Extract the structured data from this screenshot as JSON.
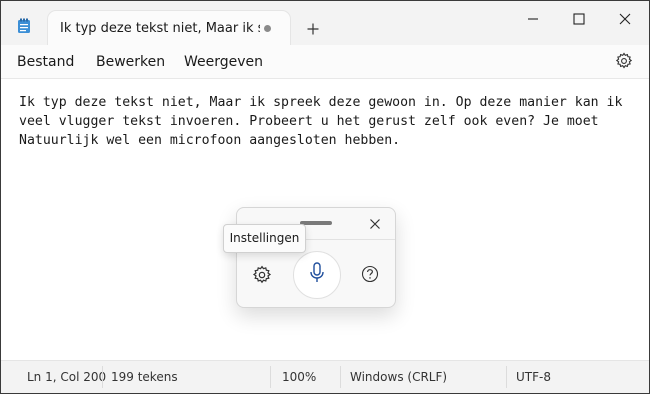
{
  "tab": {
    "title": "Ik typ deze tekst niet, Maar ik spr"
  },
  "icons": {
    "app": "notepad-icon",
    "new_tab": "plus-icon",
    "minimize": "minimize-icon",
    "maximize": "maximize-icon",
    "close": "close-icon",
    "settings": "gear-icon",
    "mic": "microphone-icon",
    "help": "question-mark-icon"
  },
  "menu": {
    "file": "Bestand",
    "edit": "Bewerken",
    "view": "Weergeven"
  },
  "editor": {
    "text": "Ik typ deze tekst niet, Maar ik spreek deze gewoon in. Op deze manier kan ik\nveel vlugger tekst invoeren. Probeert u het gerust zelf ook even? Je moet\nNatuurlijk wel een microfoon aangesloten hebben."
  },
  "voice": {
    "tooltip": "Instellingen"
  },
  "status": {
    "position": "Ln 1, Col 200",
    "chars": "199 tekens",
    "zoom": "100%",
    "line_ending": "Windows (CRLF)",
    "encoding": "UTF-8"
  },
  "colors": {
    "accent": "#1f4e9c",
    "chrome": "#f3f3f3"
  }
}
